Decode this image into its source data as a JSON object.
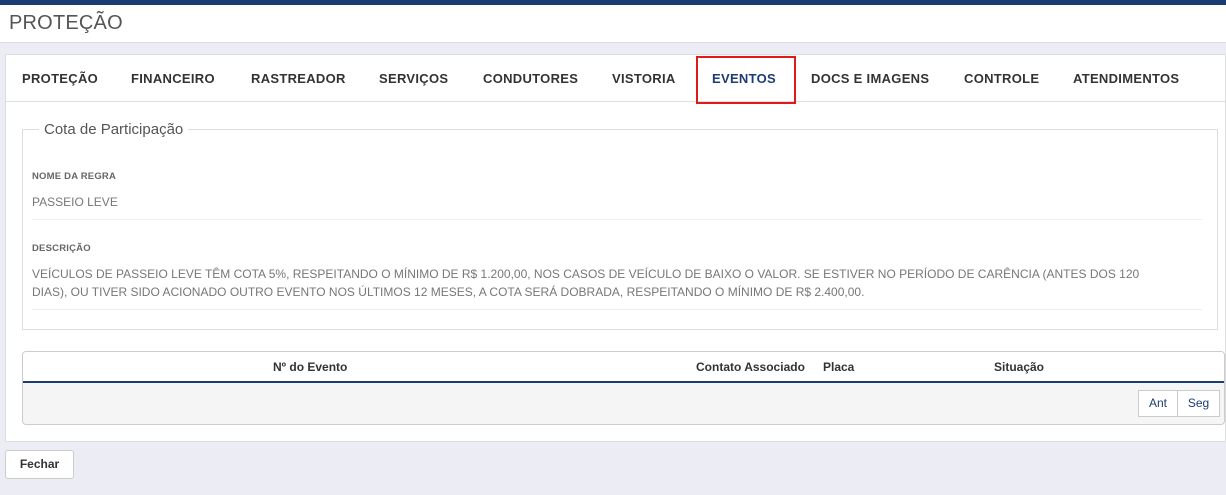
{
  "header": {
    "title": "PROTEÇÃO"
  },
  "tabs": [
    {
      "label": "PROTEÇÃO"
    },
    {
      "label": "FINANCEIRO"
    },
    {
      "label": "RASTREADOR"
    },
    {
      "label": "SERVIÇOS"
    },
    {
      "label": "CONDUTORES"
    },
    {
      "label": "VISTORIA"
    },
    {
      "label": "EVENTOS",
      "active": true
    },
    {
      "label": "DOCS E IMAGENS"
    },
    {
      "label": "CONTROLE"
    },
    {
      "label": "ATENDIMENTOS"
    }
  ],
  "cota": {
    "legend": "Cota de Participação",
    "nome_label": "NOME DA REGRA",
    "nome_value": "PASSEIO LEVE",
    "descricao_label": "DESCRIÇÃO",
    "descricao_line1": "VEÍCULOS DE PASSEIO LEVE TÊM COTA 5%, RESPEITANDO O MÍNIMO DE R$ 1.200,00, NOS CASOS DE VEÍCULO DE BAIXO O VALOR. SE ESTIVER NO PERÍODO DE CARÊNCIA (ANTES DOS 120",
    "descricao_line2": "DIAS), OU TIVER SIDO ACIONADO OUTRO EVENTO NOS ÚLTIMOS 12 MESES, A COTA SERÁ DOBRADA, RESPEITANDO O MÍNIMO DE R$ 2.400,00."
  },
  "grid": {
    "columns": [
      "Nº do Evento",
      "Contato Associado",
      "Placa",
      "Situação"
    ],
    "prev_label": "Ant",
    "next_label": "Seg"
  },
  "footer": {
    "close_label": "Fechar"
  },
  "colors": {
    "brand": "#1c3d73",
    "highlight": "#e01a1a"
  }
}
